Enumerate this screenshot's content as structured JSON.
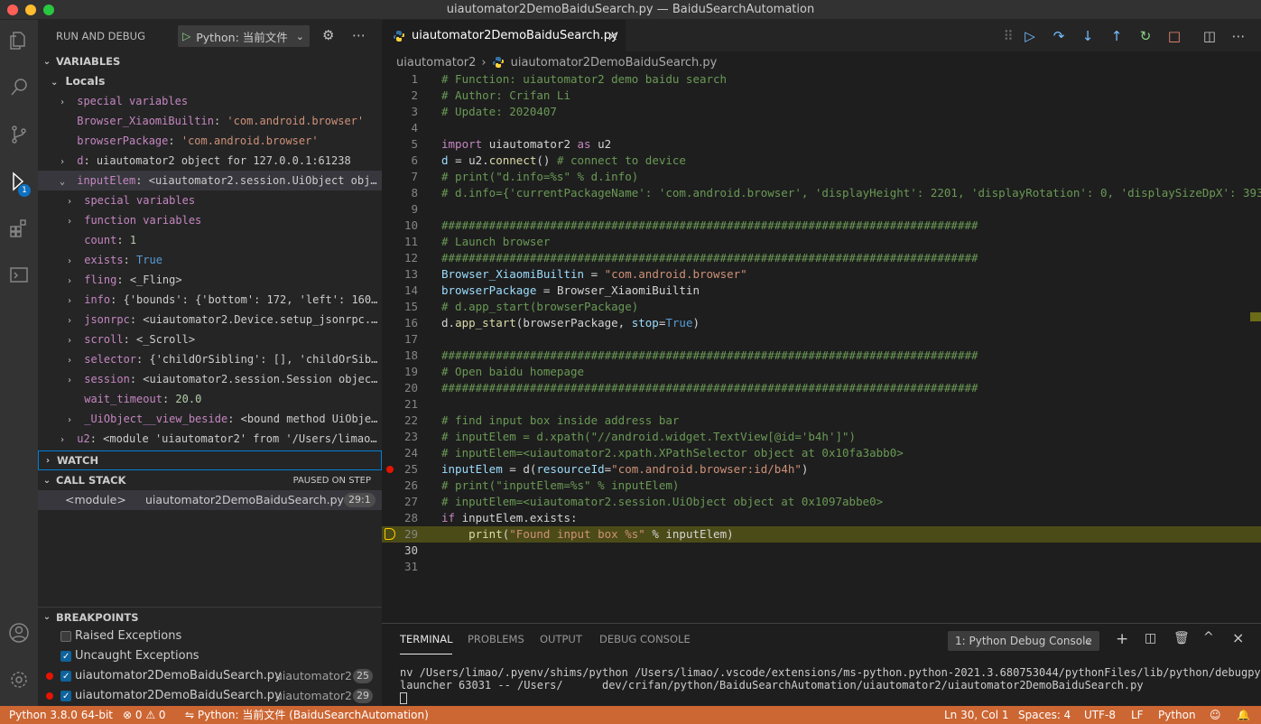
{
  "window": {
    "title": "uiautomator2DemoBaiduSearch.py — BaiduSearchAutomation"
  },
  "sidebar": {
    "title": "RUN AND DEBUG",
    "config": "Python: 当前文件",
    "variables_header": "VARIABLES",
    "locals_header": "Locals",
    "variables": [
      {
        "indent": 1,
        "twisty": "›",
        "name": "special variables",
        "value": "",
        "vtype": "plain"
      },
      {
        "indent": 1,
        "twisty": "",
        "name": "Browser_XiaomiBuiltin",
        "value": "'com.android.browser'",
        "vtype": "str"
      },
      {
        "indent": 1,
        "twisty": "",
        "name": "browserPackage",
        "value": "'com.android.browser'",
        "vtype": "str"
      },
      {
        "indent": 1,
        "twisty": "›",
        "name": "d",
        "value": "uiautomator2 object for 127.0.0.1:61238",
        "vtype": "plain"
      },
      {
        "indent": 1,
        "twisty": "⌄",
        "name": "inputElem",
        "value": "<uiautomator2.session.UiObject object at…",
        "vtype": "plain"
      },
      {
        "indent": 2,
        "twisty": "›",
        "name": "special variables",
        "value": "",
        "vtype": "plain"
      },
      {
        "indent": 2,
        "twisty": "›",
        "name": "function variables",
        "value": "",
        "vtype": "plain"
      },
      {
        "indent": 2,
        "twisty": "",
        "name": "count",
        "value": "1",
        "vtype": "num"
      },
      {
        "indent": 2,
        "twisty": "›",
        "name": "exists",
        "value": "True",
        "vtype": "kw"
      },
      {
        "indent": 2,
        "twisty": "›",
        "name": "fling",
        "value": "<_Fling>",
        "vtype": "plain"
      },
      {
        "indent": 2,
        "twisty": "›",
        "name": "info",
        "value": "{'bounds': {'bottom': 172, 'left': 160, 'ri…",
        "vtype": "plain"
      },
      {
        "indent": 2,
        "twisty": "›",
        "name": "jsonrpc",
        "value": "<uiautomator2.Device.setup_jsonrpc.<loca…",
        "vtype": "plain"
      },
      {
        "indent": 2,
        "twisty": "›",
        "name": "scroll",
        "value": "<_Scroll>",
        "vtype": "plain"
      },
      {
        "indent": 2,
        "twisty": "›",
        "name": "selector",
        "value": "{'childOrSibling': [], 'childOrSiblingS…",
        "vtype": "plain"
      },
      {
        "indent": 2,
        "twisty": "›",
        "name": "session",
        "value": "<uiautomator2.session.Session object at …",
        "vtype": "plain"
      },
      {
        "indent": 2,
        "twisty": "",
        "name": "wait_timeout",
        "value": "20.0",
        "vtype": "num"
      },
      {
        "indent": 2,
        "twisty": "›",
        "name": "_UiObject__view_beside",
        "value": "<bound method UiObject.__…",
        "vtype": "plain"
      },
      {
        "indent": 1,
        "twisty": "›",
        "name": "u2",
        "value": "<module 'uiautomator2' from '/Users/limao/.pyen…",
        "vtype": "plain"
      }
    ],
    "watch_header": "WATCH",
    "callstack_header": "CALL STACK",
    "callstack_status": "PAUSED ON STEP",
    "callstack": {
      "frame": "<module>",
      "file": "uiautomator2DemoBaiduSearch.py",
      "pos": "29:1"
    },
    "breakpoints_header": "BREAKPOINTS",
    "breakpoints": [
      {
        "checked": false,
        "dot": false,
        "label": "Raised Exceptions",
        "dir": "",
        "line": ""
      },
      {
        "checked": true,
        "dot": false,
        "label": "Uncaught Exceptions",
        "dir": "",
        "line": ""
      },
      {
        "checked": true,
        "dot": true,
        "label": "uiautomator2DemoBaiduSearch.py",
        "dir": "uiautomator2",
        "line": "25"
      },
      {
        "checked": true,
        "dot": true,
        "label": "uiautomator2DemoBaiduSearch.py",
        "dir": "uiautomator2",
        "line": "29"
      }
    ]
  },
  "editor": {
    "tab": "uiautomator2DemoBaiduSearch.py",
    "breadcrumb_dir": "uiautomator2",
    "breadcrumb_file": "uiautomator2DemoBaiduSearch.py",
    "lines": [
      [
        [
          "# Function: uiautomator2 demo baidu search",
          "com"
        ]
      ],
      [
        [
          "# Author: Crifan Li",
          "com"
        ]
      ],
      [
        [
          "# Update: 2020407",
          "com"
        ]
      ],
      [],
      [
        [
          "import ",
          "kw"
        ],
        [
          "uiautomator2 ",
          "def"
        ],
        [
          "as ",
          "kw"
        ],
        [
          "u2",
          "def"
        ]
      ],
      [
        [
          "d ",
          "var"
        ],
        [
          "= u2.",
          "def"
        ],
        [
          "connect",
          "fn"
        ],
        [
          "() ",
          "def"
        ],
        [
          "# connect to device",
          "com"
        ]
      ],
      [
        [
          "# print(\"d.info=%s\" % d.info)",
          "com"
        ]
      ],
      [
        [
          "# d.info={'currentPackageName': 'com.android.browser', 'displayHeight': 2201, 'displayRotation': 0, 'displaySizeDpX': 393, 'di",
          "com"
        ]
      ],
      [],
      [
        [
          "###############################################################################",
          "com"
        ]
      ],
      [
        [
          "# Launch browser",
          "com"
        ]
      ],
      [
        [
          "###############################################################################",
          "com"
        ]
      ],
      [
        [
          "Browser_XiaomiBuiltin ",
          "var"
        ],
        [
          "= ",
          "def"
        ],
        [
          "\"com.android.browser\"",
          "str"
        ]
      ],
      [
        [
          "browserPackage ",
          "var"
        ],
        [
          "= Browser_XiaomiBuiltin",
          "def"
        ]
      ],
      [
        [
          "# d.app_start(browserPackage)",
          "com"
        ]
      ],
      [
        [
          "d.",
          "def"
        ],
        [
          "app_start",
          "fn"
        ],
        [
          "(browserPackage, ",
          "def"
        ],
        [
          "stop",
          "var"
        ],
        [
          "=",
          "def"
        ],
        [
          "True",
          "blue"
        ],
        [
          ")",
          "def"
        ]
      ],
      [],
      [
        [
          "###############################################################################",
          "com"
        ]
      ],
      [
        [
          "# Open baidu homepage",
          "com"
        ]
      ],
      [
        [
          "###############################################################################",
          "com"
        ]
      ],
      [],
      [
        [
          "# find input box inside address bar",
          "com"
        ]
      ],
      [
        [
          "# inputElem = d.xpath(\"//android.widget.TextView[@id='b4h']\")",
          "com"
        ]
      ],
      [
        [
          "# inputElem=<uiautomator2.xpath.XPathSelector object at 0x10fa3abb0>",
          "com"
        ]
      ],
      [
        [
          "inputElem ",
          "var"
        ],
        [
          "= d(",
          "def"
        ],
        [
          "resourceId",
          "var"
        ],
        [
          "=",
          "def"
        ],
        [
          "\"com.android.browser:id/b4h\"",
          "str"
        ],
        [
          ")",
          "def"
        ]
      ],
      [
        [
          "# print(\"inputElem=%s\" % inputElem)",
          "com"
        ]
      ],
      [
        [
          "# inputElem=<uiautomator2.session.UiObject object at 0x1097abbe0>",
          "com"
        ]
      ],
      [
        [
          "if ",
          "kw"
        ],
        [
          "inputElem.exists:",
          "def"
        ]
      ],
      [
        [
          "    ",
          "def"
        ],
        [
          "print",
          "fn"
        ],
        [
          "(",
          "def"
        ],
        [
          "\"Found input box %s\"",
          "str"
        ],
        [
          " % inputElem)",
          "def"
        ]
      ],
      [],
      []
    ],
    "current_line": 29,
    "breakpoint_line": 25
  },
  "panel": {
    "tabs": [
      "TERMINAL",
      "PROBLEMS",
      "OUTPUT",
      "DEBUG CONSOLE"
    ],
    "terminal_select": "1: Python Debug Console",
    "terminal_lines": [
      "nv /Users/limao/.pyenv/shims/python /Users/limao/.vscode/extensions/ms-python.python-2021.3.680753044/pythonFiles/lib/python/debugpy/",
      "launcher 63031 -- /Users/      dev/crifan/python/BaiduSearchAutomation/uiautomator2/uiautomator2DemoBaiduSearch.py"
    ]
  },
  "statusbar": {
    "interpreter": "Python 3.8.0 64-bit",
    "problems": "⊗ 0 ⚠ 0",
    "debug": "Python: 当前文件 (BaiduSearchAutomation)",
    "position": "Ln 30, Col 1",
    "spaces": "Spaces: 4",
    "encoding": "UTF-8",
    "eol": "LF",
    "language": "Python"
  },
  "colors": {
    "statusbar": "#cc6633",
    "accent": "#0e639c",
    "breakpoint": "#e51400"
  }
}
